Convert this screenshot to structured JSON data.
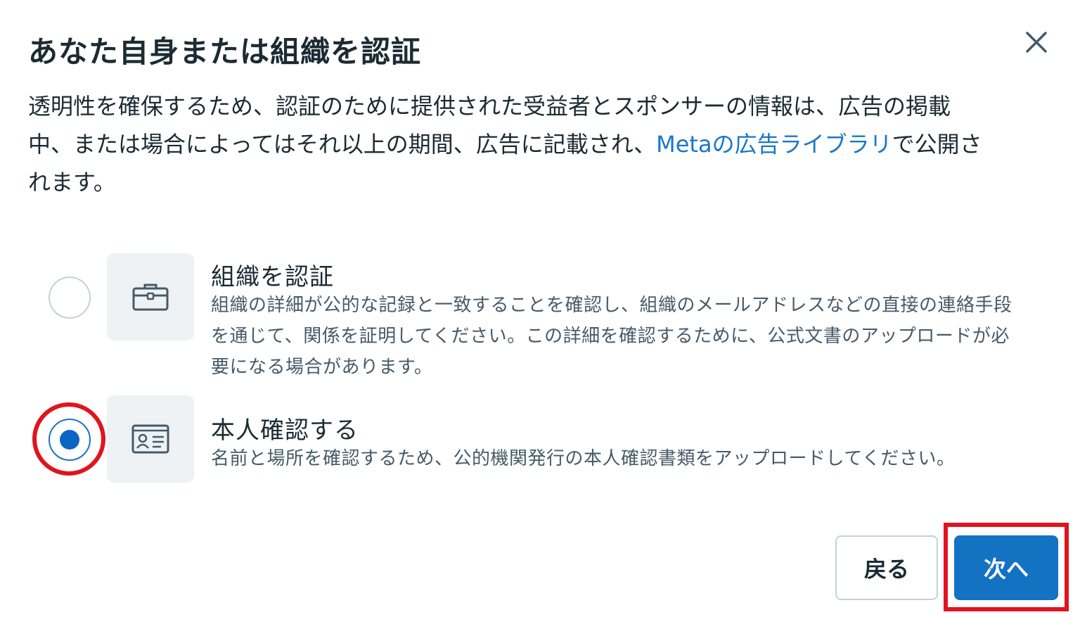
{
  "dialog": {
    "title": "あなた自身または組織を認証",
    "close_icon": "close-icon",
    "description_before_link": "透明性を確保するため、認証のために提供された受益者とスポンサーの情報は、広告の掲載中、または場合によってはそれ以上の期間、広告に記載され、",
    "description_link": "Metaの広告ライブラリ",
    "description_after_link": "で公開されます。"
  },
  "options": [
    {
      "icon": "briefcase-icon",
      "title": "組織を認証",
      "description": "組織の詳細が公的な記録と一致することを確認し、組織のメールアドレスなどの直接の連絡手段を通じて、関係を証明してください。この詳細を確認するために、公式文書のアップロードが必要になる場合があります。",
      "selected": false
    },
    {
      "icon": "id-card-icon",
      "title": "本人確認する",
      "description": "名前と場所を確認するため、公的機関発行の本人確認書類をアップロードしてください。",
      "selected": true
    }
  ],
  "footer": {
    "back_label": "戻る",
    "next_label": "次へ"
  },
  "colors": {
    "accent": "#1472c2",
    "link": "#1877c9",
    "highlight": "#e0141e"
  }
}
